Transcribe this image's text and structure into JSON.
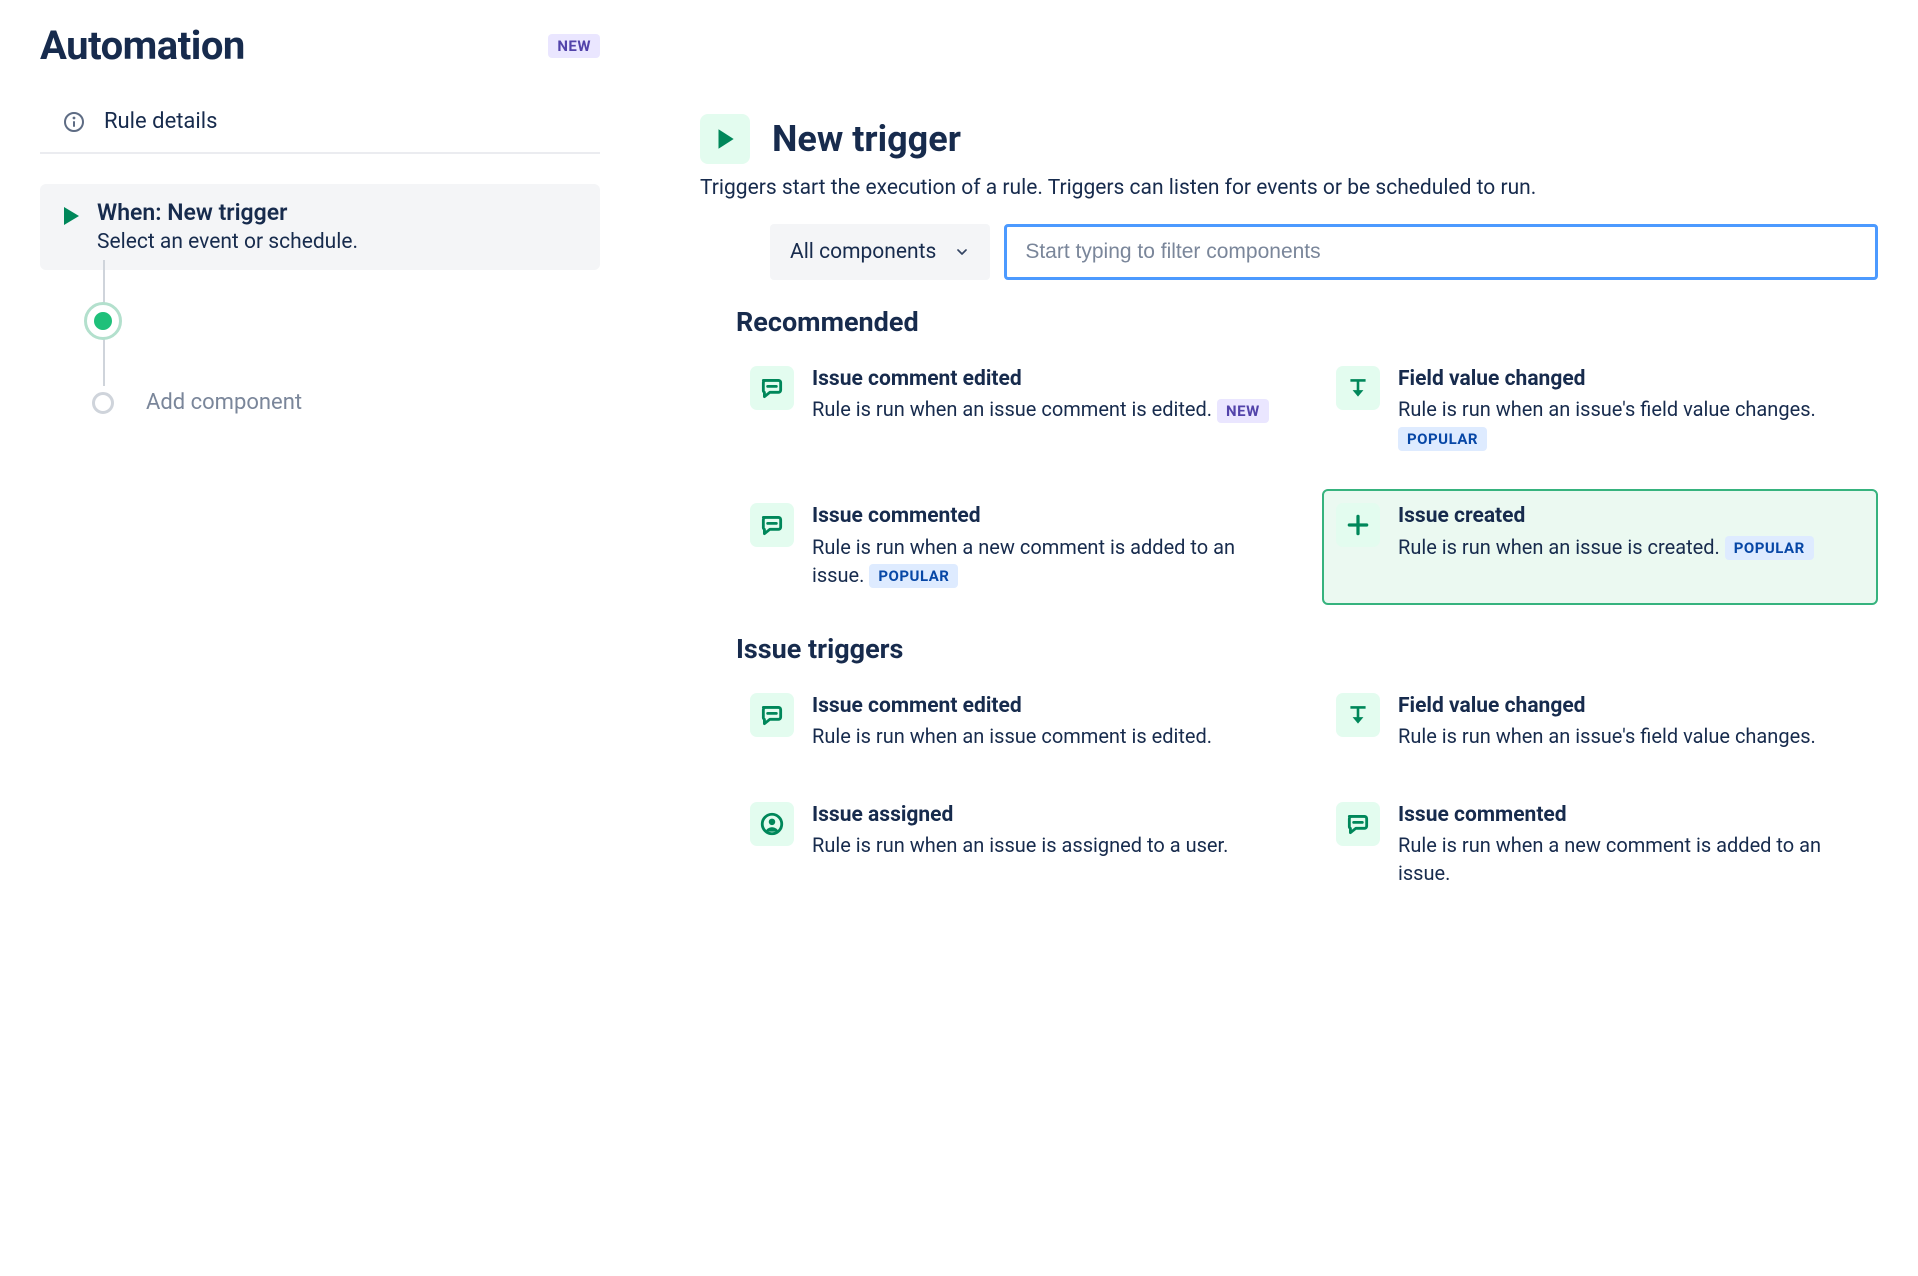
{
  "page": {
    "title": "Automation",
    "badge": "NEW"
  },
  "sidebar": {
    "rule_details": "Rule details",
    "trigger_step": {
      "title": "When: New trigger",
      "subtitle": "Select an event or schedule."
    },
    "add_component": "Add component"
  },
  "trigger_panel": {
    "title": "New trigger",
    "description": "Triggers start the execution of a rule. Triggers can listen for events or be scheduled to run.",
    "filter_select": "All components",
    "search_placeholder": "Start typing to filter components"
  },
  "groups": {
    "recommended": "Recommended",
    "issue_triggers": "Issue triggers"
  },
  "cards": {
    "rec": [
      {
        "title": "Issue comment edited",
        "desc": "Rule is run when an issue comment is edited.",
        "badge": "NEW",
        "icon": "comment"
      },
      {
        "title": "Field value changed",
        "desc": "Rule is run when an issue's field value changes.",
        "badge": "POPULAR",
        "icon": "field"
      },
      {
        "title": "Issue commented",
        "desc": "Rule is run when a new comment is added to an issue.",
        "badge": "POPULAR",
        "icon": "comment"
      },
      {
        "title": "Issue created",
        "desc": "Rule is run when an issue is created.",
        "badge": "POPULAR",
        "icon": "plus",
        "selected": true
      }
    ],
    "issue": [
      {
        "title": "Issue comment edited",
        "desc": "Rule is run when an issue comment is edited.",
        "icon": "comment"
      },
      {
        "title": "Field value changed",
        "desc": "Rule is run when an issue's field value changes.",
        "icon": "field"
      },
      {
        "title": "Issue assigned",
        "desc": "Rule is run when an issue is assigned to a user.",
        "icon": "person"
      },
      {
        "title": "Issue commented",
        "desc": "Rule is run when a new comment is added to an issue.",
        "icon": "comment"
      }
    ]
  }
}
